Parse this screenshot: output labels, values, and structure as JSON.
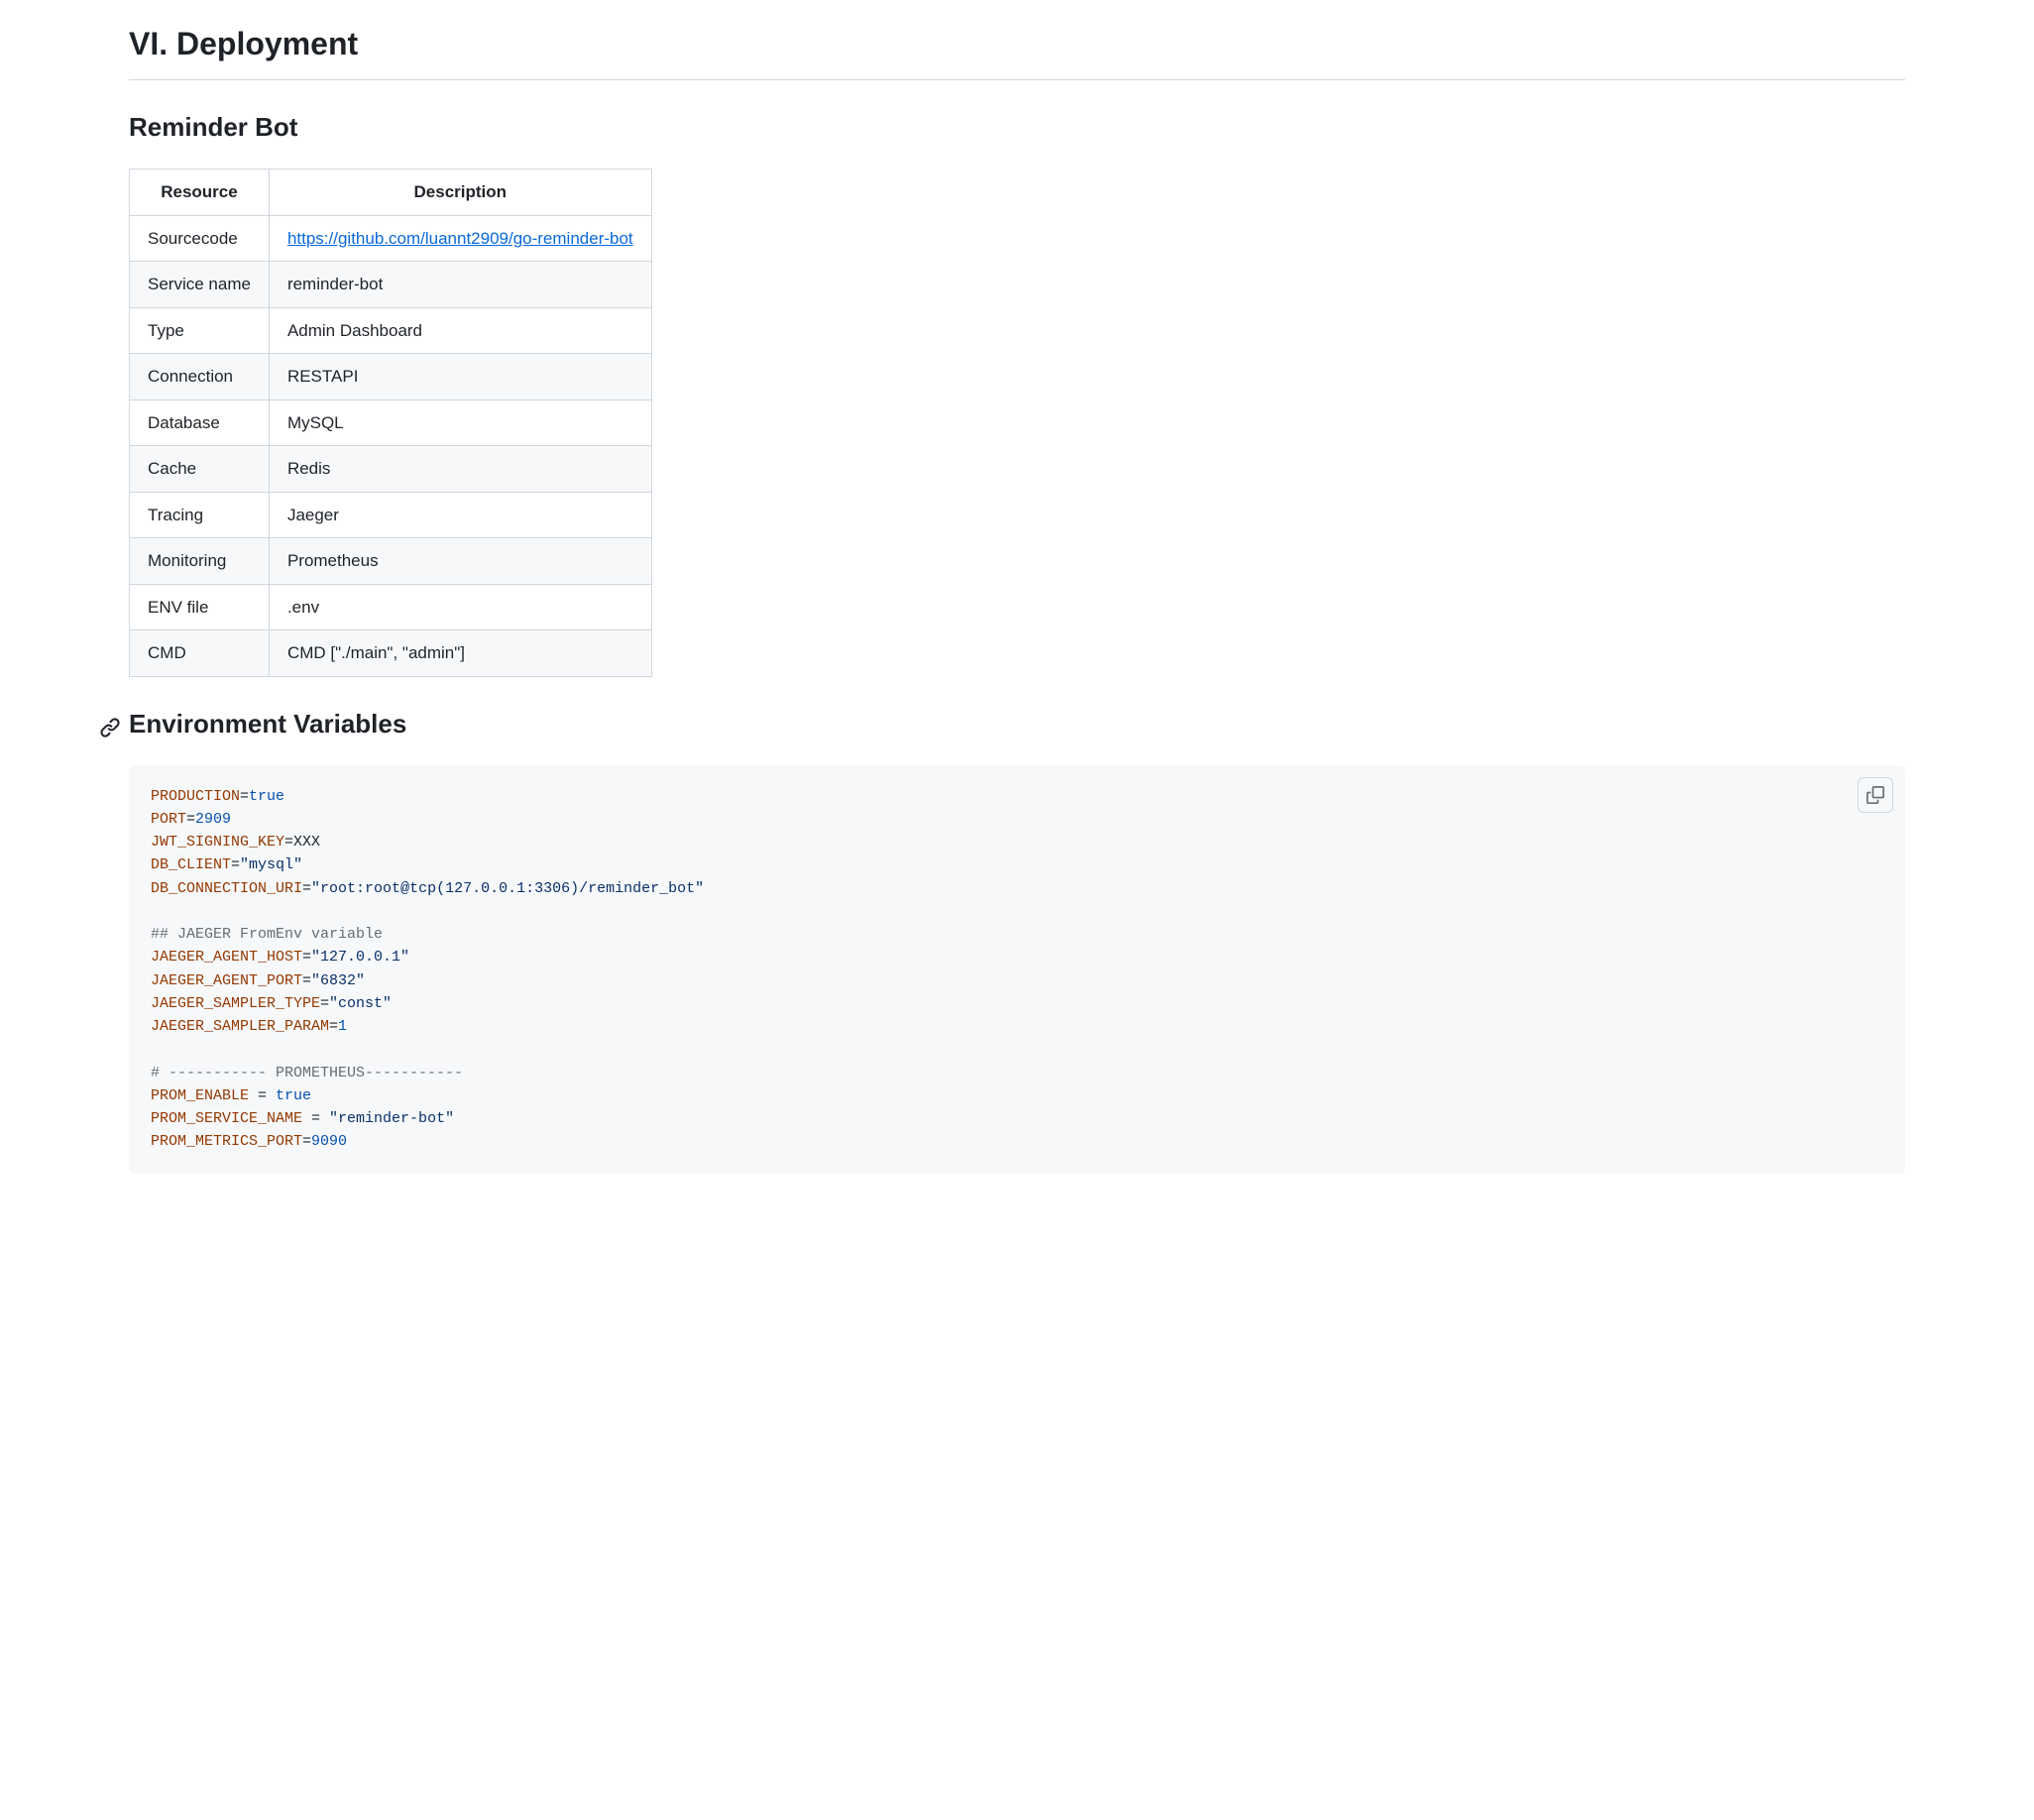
{
  "section": {
    "title": "VI. Deployment"
  },
  "subsection": {
    "title": "Reminder Bot"
  },
  "table": {
    "headers": {
      "col1": "Resource",
      "col2": "Description"
    },
    "rows": [
      {
        "resource": "Sourcecode",
        "description": "https://github.com/luannt2909/go-reminder-bot",
        "is_link": true
      },
      {
        "resource": "Service name",
        "description": "reminder-bot"
      },
      {
        "resource": "Type",
        "description": "Admin Dashboard"
      },
      {
        "resource": "Connection",
        "description": "RESTAPI"
      },
      {
        "resource": "Database",
        "description": "MySQL"
      },
      {
        "resource": "Cache",
        "description": "Redis"
      },
      {
        "resource": "Tracing",
        "description": "Jaeger"
      },
      {
        "resource": "Monitoring",
        "description": "Prometheus"
      },
      {
        "resource": "ENV file",
        "description": ".env"
      },
      {
        "resource": "CMD",
        "description": "CMD [\"./main\", \"admin\"]"
      }
    ]
  },
  "env_section": {
    "title": "Environment Variables"
  },
  "code_lines": [
    [
      {
        "t": "key",
        "v": "PRODUCTION"
      },
      {
        "t": "op",
        "v": "="
      },
      {
        "t": "bool",
        "v": "true"
      }
    ],
    [
      {
        "t": "key",
        "v": "PORT"
      },
      {
        "t": "op",
        "v": "="
      },
      {
        "t": "num",
        "v": "2909"
      }
    ],
    [
      {
        "t": "key",
        "v": "JWT_SIGNING_KEY"
      },
      {
        "t": "op",
        "v": "="
      },
      {
        "t": "var",
        "v": "XXX"
      }
    ],
    [
      {
        "t": "key",
        "v": "DB_CLIENT"
      },
      {
        "t": "op",
        "v": "="
      },
      {
        "t": "str",
        "v": "\"mysql\""
      }
    ],
    [
      {
        "t": "key",
        "v": "DB_CONNECTION_URI"
      },
      {
        "t": "op",
        "v": "="
      },
      {
        "t": "str",
        "v": "\"root:root@tcp(127.0.0.1:3306)/reminder_bot\""
      }
    ],
    [],
    [
      {
        "t": "cmt",
        "v": "## JAEGER FromEnv variable"
      }
    ],
    [
      {
        "t": "key",
        "v": "JAEGER_AGENT_HOST"
      },
      {
        "t": "op",
        "v": "="
      },
      {
        "t": "str",
        "v": "\"127.0.0.1\""
      }
    ],
    [
      {
        "t": "key",
        "v": "JAEGER_AGENT_PORT"
      },
      {
        "t": "op",
        "v": "="
      },
      {
        "t": "str",
        "v": "\"6832\""
      }
    ],
    [
      {
        "t": "key",
        "v": "JAEGER_SAMPLER_TYPE"
      },
      {
        "t": "op",
        "v": "="
      },
      {
        "t": "str",
        "v": "\"const\""
      }
    ],
    [
      {
        "t": "key",
        "v": "JAEGER_SAMPLER_PARAM"
      },
      {
        "t": "op",
        "v": "="
      },
      {
        "t": "num",
        "v": "1"
      }
    ],
    [],
    [
      {
        "t": "cmt",
        "v": "# ----------- PROMETHEUS-----------"
      }
    ],
    [
      {
        "t": "key",
        "v": "PROM_ENABLE"
      },
      {
        "t": "op",
        "v": " = "
      },
      {
        "t": "bool",
        "v": "true"
      }
    ],
    [
      {
        "t": "key",
        "v": "PROM_SERVICE_NAME"
      },
      {
        "t": "op",
        "v": " = "
      },
      {
        "t": "str",
        "v": "\"reminder-bot\""
      }
    ],
    [
      {
        "t": "key",
        "v": "PROM_METRICS_PORT"
      },
      {
        "t": "op",
        "v": "="
      },
      {
        "t": "num",
        "v": "9090"
      }
    ]
  ]
}
